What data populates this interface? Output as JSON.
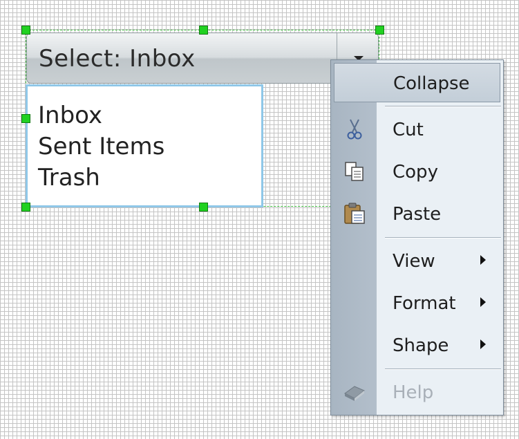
{
  "combo": {
    "title": "Select: Inbox",
    "items": [
      "Inbox",
      "Sent Items",
      "Trash"
    ]
  },
  "context_menu": {
    "items": [
      {
        "label": "Collapse",
        "icon": null,
        "submenu": false,
        "state": "highlighted"
      },
      {
        "label": "Cut",
        "icon": "scissors-icon",
        "submenu": false,
        "state": "normal"
      },
      {
        "label": "Copy",
        "icon": "copy-icon",
        "submenu": false,
        "state": "normal"
      },
      {
        "label": "Paste",
        "icon": "paste-icon",
        "submenu": false,
        "state": "normal"
      },
      {
        "label": "View",
        "icon": null,
        "submenu": true,
        "state": "normal"
      },
      {
        "label": "Format",
        "icon": null,
        "submenu": true,
        "state": "normal"
      },
      {
        "label": "Shape",
        "icon": null,
        "submenu": true,
        "state": "normal"
      },
      {
        "label": "Help",
        "icon": "help-book-icon",
        "submenu": false,
        "state": "disabled"
      }
    ]
  },
  "colors": {
    "selection_handle": "#21d121",
    "listbox_border": "#8fc7e8",
    "menu_gutter": "#a8b5c2",
    "menu_background": "#eaf0f5"
  }
}
